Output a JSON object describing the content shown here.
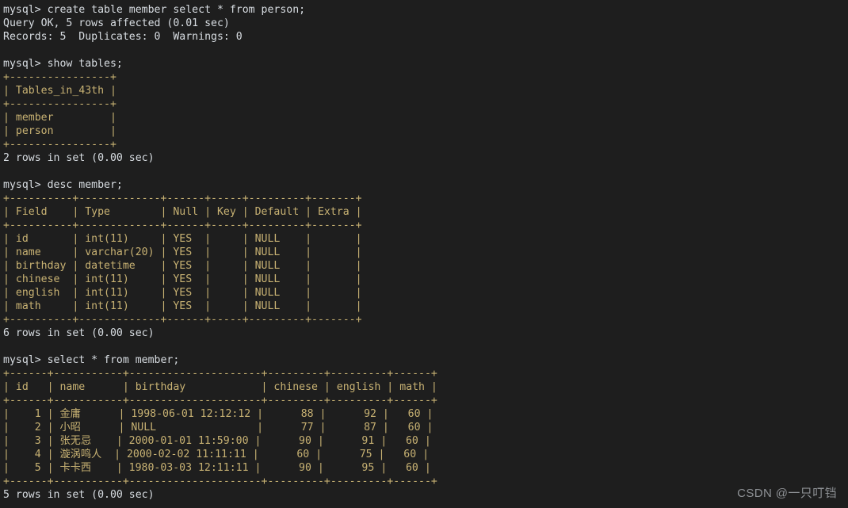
{
  "terminal": {
    "background_color": "#1e1e1e",
    "text_color": "#d8dde2",
    "border_color": "#c8b273",
    "prompt": "mysql>",
    "watermark": "CSDN @一只叮铛"
  },
  "blocks": {
    "create_table": {
      "command": "mysql> create table member select * from person;",
      "result_line_1": "Query OK, 5 rows affected (0.01 sec)",
      "result_line_2": "Records: 5  Duplicates: 0  Warnings: 0"
    },
    "show_tables": {
      "command": "mysql> show tables;",
      "rule": "+----------------+",
      "header": "| Tables_in_43th |",
      "rows": [
        "| member         |",
        "| person         |"
      ],
      "footer": "2 rows in set (0.00 sec)",
      "header_label": "Tables_in_43th",
      "table_names": [
        "member",
        "person"
      ],
      "row_count": "2 rows in set (0.00 sec)"
    },
    "desc_member": {
      "command": "mysql> desc member;",
      "rule": "+----------+-------------+------+-----+---------+-------+",
      "header": "| Field    | Type        | Null | Key | Default | Extra |",
      "columns": [
        "Field",
        "Type",
        "Null",
        "Key",
        "Default",
        "Extra"
      ],
      "rows": [
        "| id       | int(11)     | YES  |     | NULL    |       |",
        "| name     | varchar(20) | YES  |     | NULL    |       |",
        "| birthday | datetime    | YES  |     | NULL    |       |",
        "| chinese  | int(11)     | YES  |     | NULL    |       |",
        "| english  | int(11)     | YES  |     | NULL    |       |",
        "| math     | int(11)     | YES  |     | NULL    |       |"
      ],
      "fields": [
        {
          "field": "id",
          "type": "int(11)",
          "null": "YES",
          "key": "",
          "default": "NULL",
          "extra": ""
        },
        {
          "field": "name",
          "type": "varchar(20)",
          "null": "YES",
          "key": "",
          "default": "NULL",
          "extra": ""
        },
        {
          "field": "birthday",
          "type": "datetime",
          "null": "YES",
          "key": "",
          "default": "NULL",
          "extra": ""
        },
        {
          "field": "chinese",
          "type": "int(11)",
          "null": "YES",
          "key": "",
          "default": "NULL",
          "extra": ""
        },
        {
          "field": "english",
          "type": "int(11)",
          "null": "YES",
          "key": "",
          "default": "NULL",
          "extra": ""
        },
        {
          "field": "math",
          "type": "int(11)",
          "null": "YES",
          "key": "",
          "default": "NULL",
          "extra": ""
        }
      ],
      "footer": "6 rows in set (0.00 sec)"
    },
    "select_member": {
      "command": "mysql> select * from member;",
      "rule": "+------+-----------+---------------------+---------+---------+------+",
      "header": "| id   | name      | birthday            | chinese | english | math |",
      "columns": [
        "id",
        "name",
        "birthday",
        "chinese",
        "english",
        "math"
      ],
      "rows": [
        "|    1 | 金庸      | 1998-06-01 12:12:12 |      88 |      92 |   60 |",
        "|    2 | 小昭      | NULL                |      77 |      87 |   60 |",
        "|    3 | 张无忌    | 2000-01-01 11:59:00 |      90 |      91 |   60 |",
        "|    4 | 漩涡鸣人  | 2000-02-02 11:11:11 |      60 |      75 |   60 |",
        "|    5 | 卡卡西    | 1980-03-03 12:11:11 |      90 |      95 |   60 |"
      ],
      "records": [
        {
          "id": "1",
          "name": "金庸",
          "birthday": "1998-06-01 12:12:12",
          "chinese": "88",
          "english": "92",
          "math": "60"
        },
        {
          "id": "2",
          "name": "小昭",
          "birthday": "NULL",
          "chinese": "77",
          "english": "87",
          "math": "60"
        },
        {
          "id": "3",
          "name": "张无忌",
          "birthday": "2000-01-01 11:59:00",
          "chinese": "90",
          "english": "91",
          "math": "60"
        },
        {
          "id": "4",
          "name": "漩涡鸣人",
          "birthday": "2000-02-02 11:11:11",
          "chinese": "60",
          "english": "75",
          "math": "60"
        },
        {
          "id": "5",
          "name": "卡卡西",
          "birthday": "1980-03-03 12:11:11",
          "chinese": "90",
          "english": "95",
          "math": "60"
        }
      ],
      "footer": "5 rows in set (0.00 sec)"
    }
  }
}
